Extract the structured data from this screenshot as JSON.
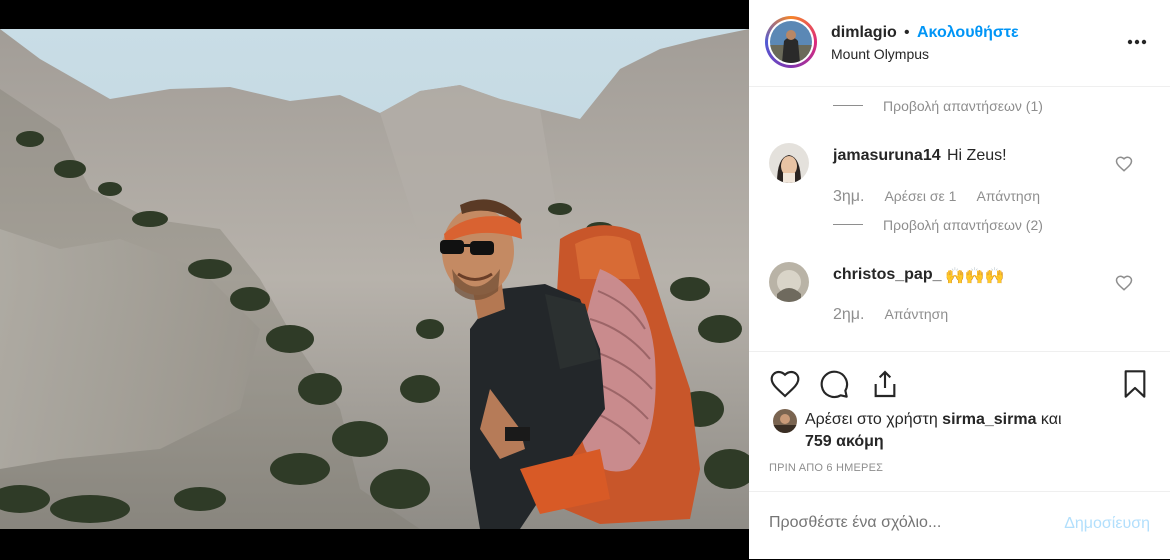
{
  "post": {
    "username": "dimlagio",
    "separator": "•",
    "follow_label": "Ακολουθήστε",
    "location": "Mount Olympus"
  },
  "comments": [
    {
      "replies_label": "Προβολή απαντήσεων (1)"
    },
    {
      "username": "jamasuruna14",
      "text": "Hi Zeus!",
      "time": "3ημ.",
      "likes": "Αρέσει σε 1",
      "reply_label": "Απάντηση",
      "replies_label": "Προβολή απαντήσεων (2)"
    },
    {
      "username": "christos_pap_",
      "text": "🙌🙌🙌",
      "time": "2ημ.",
      "reply_label": "Απάντηση"
    }
  ],
  "likes": {
    "prefix": "Αρέσει στο χρήστη",
    "user": "sirma_sirma",
    "middle": "και",
    "count": "759 ακόμη"
  },
  "timestamp": "ΠΡΙΝ ΑΠΟ 6 ΗΜΕΡΕΣ",
  "add_comment": {
    "placeholder": "Προσθέστε ένα σχόλιο...",
    "post_label": "Δημοσίευση"
  },
  "icons": [
    "more-icon",
    "heart-icon",
    "comment-icon",
    "share-icon",
    "bookmark-icon"
  ],
  "colors": {
    "link": "#0095f6",
    "muted": "#8e8e8e",
    "text": "#262626",
    "post_disabled": "#b2dffc"
  }
}
